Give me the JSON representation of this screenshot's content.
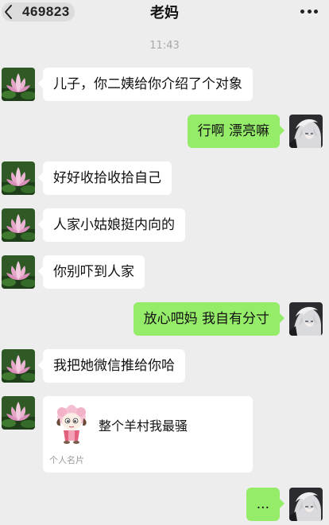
{
  "header": {
    "back_count": "469823",
    "title": "老妈"
  },
  "timestamp": "11:43",
  "messages": [
    {
      "side": "in",
      "text": "儿子，你二姨给你介绍了个对象"
    },
    {
      "side": "out",
      "text": "行啊 漂亮嘛"
    },
    {
      "side": "in",
      "text": "好好收拾收拾自己"
    },
    {
      "side": "in",
      "text": "人家小姑娘挺内向的"
    },
    {
      "side": "in",
      "text": "你别吓到人家"
    },
    {
      "side": "out",
      "text": "放心吧妈 我自有分寸"
    },
    {
      "side": "in",
      "text": "我把她微信推给你哈"
    },
    {
      "side": "out",
      "text": "..."
    }
  ],
  "contact_card": {
    "name": "整个羊村我最骚",
    "label": "个人名片",
    "icon": "sheep-cartoon-avatar"
  },
  "colors": {
    "background": "#ededed",
    "outgoing_bubble": "#95ec69",
    "incoming_bubble": "#ffffff"
  },
  "icons": {
    "back": "chevron-left-icon",
    "more": "more-dots-icon",
    "mom_avatar": "lotus-avatar",
    "me_avatar": "anime-portrait-avatar"
  }
}
